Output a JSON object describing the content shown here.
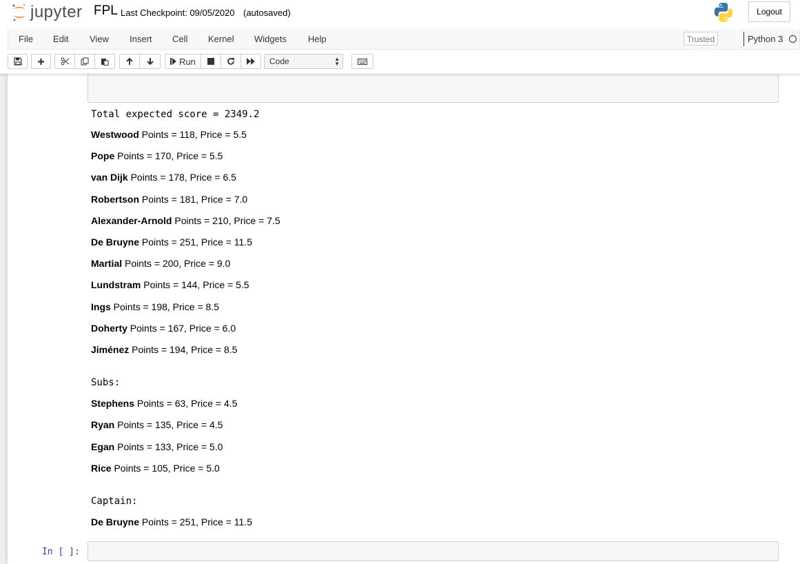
{
  "header": {
    "logo_text": "jupyter",
    "notebook_title": "FPL",
    "checkpoint": "Last Checkpoint: 09/05/2020",
    "autosave_status": "(autosaved)",
    "logout_label": "Logout"
  },
  "menubar": {
    "items": [
      "File",
      "Edit",
      "View",
      "Insert",
      "Cell",
      "Kernel",
      "Widgets",
      "Help"
    ],
    "trusted_label": "Trusted",
    "kernel_name": "Python 3"
  },
  "toolbar": {
    "run_label": "Run",
    "cell_type": "Code",
    "icons": [
      "save-icon",
      "plus-icon",
      "cut-icon",
      "copy-icon",
      "paste-icon",
      "arrow-up-icon",
      "arrow-down-icon",
      "run-icon",
      "stop-icon",
      "restart-icon",
      "fast-forward-icon",
      "keyboard-icon"
    ]
  },
  "output": {
    "total_line": "Total expected score = 2349.2",
    "players": [
      {
        "name": "Westwood",
        "detail": "Points = 118, Price = 5.5"
      },
      {
        "name": "Pope",
        "detail": "Points = 170, Price = 5.5"
      },
      {
        "name": "van Dijk",
        "detail": "Points = 178, Price = 6.5"
      },
      {
        "name": "Robertson",
        "detail": "Points = 181, Price = 7.0"
      },
      {
        "name": "Alexander-Arnold",
        "detail": "Points = 210, Price = 7.5"
      },
      {
        "name": "De Bruyne",
        "detail": "Points = 251, Price = 11.5"
      },
      {
        "name": "Martial",
        "detail": "Points = 200, Price = 9.0"
      },
      {
        "name": "Lundstram",
        "detail": "Points = 144, Price = 5.5"
      },
      {
        "name": "Ings",
        "detail": "Points = 198, Price = 8.5"
      },
      {
        "name": "Doherty",
        "detail": "Points = 167, Price = 6.0"
      },
      {
        "name": "Jiménez",
        "detail": "Points = 194, Price = 8.5"
      }
    ],
    "subs_heading": "Subs:",
    "subs": [
      {
        "name": "Stephens",
        "detail": "Points = 63, Price = 4.5"
      },
      {
        "name": "Ryan",
        "detail": "Points = 135, Price = 4.5"
      },
      {
        "name": "Egan",
        "detail": "Points = 133, Price = 5.0"
      },
      {
        "name": "Rice",
        "detail": "Points = 105, Price = 5.0"
      }
    ],
    "captain_heading": "Captain:",
    "captain": {
      "name": "De Bruyne",
      "detail": "Points = 251, Price = 11.5"
    }
  },
  "next_cell": {
    "prompt": "In [ ]:"
  },
  "colors": {
    "jupyter_orange": "#F37726",
    "prompt_blue": "#303F9F",
    "python_blue": "#3776AB",
    "python_yellow": "#FFD43B"
  }
}
